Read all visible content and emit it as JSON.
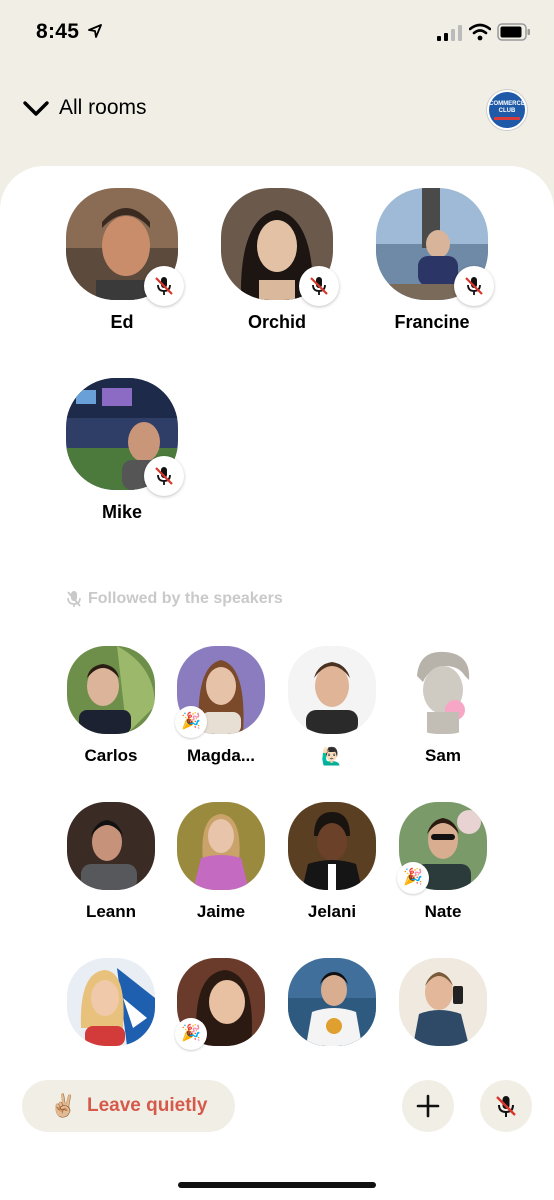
{
  "status": {
    "time": "8:45"
  },
  "header": {
    "back_label": "All rooms",
    "club_logo_text": "COMMERCE CLUB"
  },
  "speakers": [
    {
      "name": "Ed",
      "muted": true
    },
    {
      "name": "Orchid",
      "muted": true
    },
    {
      "name": "Francine",
      "muted": true
    },
    {
      "name": "Mike",
      "muted": true
    }
  ],
  "followed_label": "Followed by the speakers",
  "listeners": [
    {
      "name": "Carlos",
      "new": false
    },
    {
      "name": "Magda...",
      "new": true
    },
    {
      "name": "🙋🏻‍♂️",
      "new": false
    },
    {
      "name": "Sam",
      "new": false
    },
    {
      "name": "Leann",
      "new": false
    },
    {
      "name": "Jaime",
      "new": false
    },
    {
      "name": "Jelani",
      "new": false
    },
    {
      "name": "Nate",
      "new": true
    },
    {
      "name": "",
      "new": false
    },
    {
      "name": "",
      "new": true
    },
    {
      "name": "",
      "new": false
    },
    {
      "name": "",
      "new": false
    }
  ],
  "footer": {
    "leave_emoji": "✌🏼",
    "leave_label": "Leave quietly"
  },
  "colors": {
    "background": "#f1efe5",
    "leave_text": "#d55a4c",
    "mute_red": "#d9362b",
    "club_blue": "#1e5aa8"
  }
}
